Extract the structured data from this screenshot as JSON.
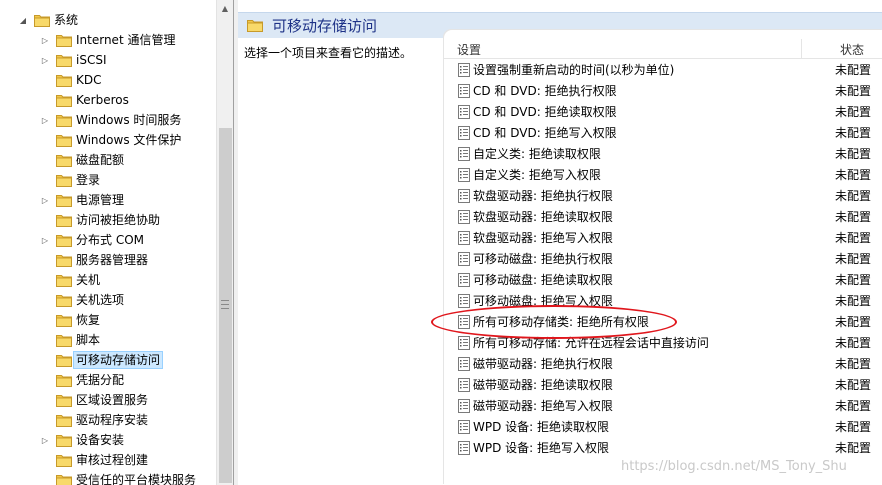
{
  "tree": {
    "items": [
      {
        "label": "系统",
        "expander": "open",
        "level": 0,
        "selected": false
      },
      {
        "label": "Internet 通信管理",
        "expander": "closed",
        "level": 1,
        "selected": false
      },
      {
        "label": "iSCSI",
        "expander": "closed",
        "level": 1,
        "selected": false
      },
      {
        "label": "KDC",
        "expander": "none",
        "level": 1,
        "selected": false
      },
      {
        "label": "Kerberos",
        "expander": "none",
        "level": 1,
        "selected": false
      },
      {
        "label": "Windows 时间服务",
        "expander": "closed",
        "level": 1,
        "selected": false
      },
      {
        "label": "Windows 文件保护",
        "expander": "none",
        "level": 1,
        "selected": false
      },
      {
        "label": "磁盘配额",
        "expander": "none",
        "level": 1,
        "selected": false
      },
      {
        "label": "登录",
        "expander": "none",
        "level": 1,
        "selected": false
      },
      {
        "label": "电源管理",
        "expander": "closed",
        "level": 1,
        "selected": false
      },
      {
        "label": "访问被拒绝协助",
        "expander": "none",
        "level": 1,
        "selected": false
      },
      {
        "label": "分布式 COM",
        "expander": "closed",
        "level": 1,
        "selected": false
      },
      {
        "label": "服务器管理器",
        "expander": "none",
        "level": 1,
        "selected": false
      },
      {
        "label": "关机",
        "expander": "none",
        "level": 1,
        "selected": false
      },
      {
        "label": "关机选项",
        "expander": "none",
        "level": 1,
        "selected": false
      },
      {
        "label": "恢复",
        "expander": "none",
        "level": 1,
        "selected": false
      },
      {
        "label": "脚本",
        "expander": "none",
        "level": 1,
        "selected": false
      },
      {
        "label": "可移动存储访问",
        "expander": "none",
        "level": 1,
        "selected": true
      },
      {
        "label": "凭据分配",
        "expander": "none",
        "level": 1,
        "selected": false
      },
      {
        "label": "区域设置服务",
        "expander": "none",
        "level": 1,
        "selected": false
      },
      {
        "label": "驱动程序安装",
        "expander": "none",
        "level": 1,
        "selected": false
      },
      {
        "label": "设备安装",
        "expander": "closed",
        "level": 1,
        "selected": false
      },
      {
        "label": "审核过程创建",
        "expander": "none",
        "level": 1,
        "selected": false
      },
      {
        "label": "受信任的平台模块服务",
        "expander": "none",
        "level": 1,
        "selected": false
      }
    ]
  },
  "right": {
    "title": "可移动存储访问",
    "description": "选择一个项目来查看它的描述。",
    "columns": {
      "setting": "设置",
      "state": "状态"
    },
    "policies": [
      {
        "name": "设置强制重新启动的时间(以秒为单位)",
        "state": "未配置"
      },
      {
        "name": "CD 和 DVD: 拒绝执行权限",
        "state": "未配置"
      },
      {
        "name": "CD 和 DVD: 拒绝读取权限",
        "state": "未配置"
      },
      {
        "name": "CD 和 DVD: 拒绝写入权限",
        "state": "未配置"
      },
      {
        "name": "自定义类: 拒绝读取权限",
        "state": "未配置"
      },
      {
        "name": "自定义类: 拒绝写入权限",
        "state": "未配置"
      },
      {
        "name": "软盘驱动器: 拒绝执行权限",
        "state": "未配置"
      },
      {
        "name": "软盘驱动器: 拒绝读取权限",
        "state": "未配置"
      },
      {
        "name": "软盘驱动器: 拒绝写入权限",
        "state": "未配置"
      },
      {
        "name": "可移动磁盘: 拒绝执行权限",
        "state": "未配置"
      },
      {
        "name": "可移动磁盘: 拒绝读取权限",
        "state": "未配置"
      },
      {
        "name": "可移动磁盘: 拒绝写入权限",
        "state": "未配置"
      },
      {
        "name": "所有可移动存储类: 拒绝所有权限",
        "state": "未配置"
      },
      {
        "name": "所有可移动存储: 允许在远程会话中直接访问",
        "state": "未配置"
      },
      {
        "name": "磁带驱动器: 拒绝执行权限",
        "state": "未配置"
      },
      {
        "name": "磁带驱动器: 拒绝读取权限",
        "state": "未配置"
      },
      {
        "name": "磁带驱动器: 拒绝写入权限",
        "state": "未配置"
      },
      {
        "name": "WPD 设备: 拒绝读取权限",
        "state": "未配置"
      },
      {
        "name": "WPD 设备: 拒绝写入权限",
        "state": "未配置"
      }
    ]
  },
  "watermark": "https://blog.csdn.net/MS_Tony_Shu",
  "colors": {
    "selection": "#cce8ff",
    "title_bar": "#dce8f5",
    "title_text": "#1e3287",
    "annotation": "#e0161c",
    "folder": "#f2c84b"
  },
  "icons": {
    "tree_item": "folder-icon",
    "policy_item": "policy-setting-icon"
  }
}
